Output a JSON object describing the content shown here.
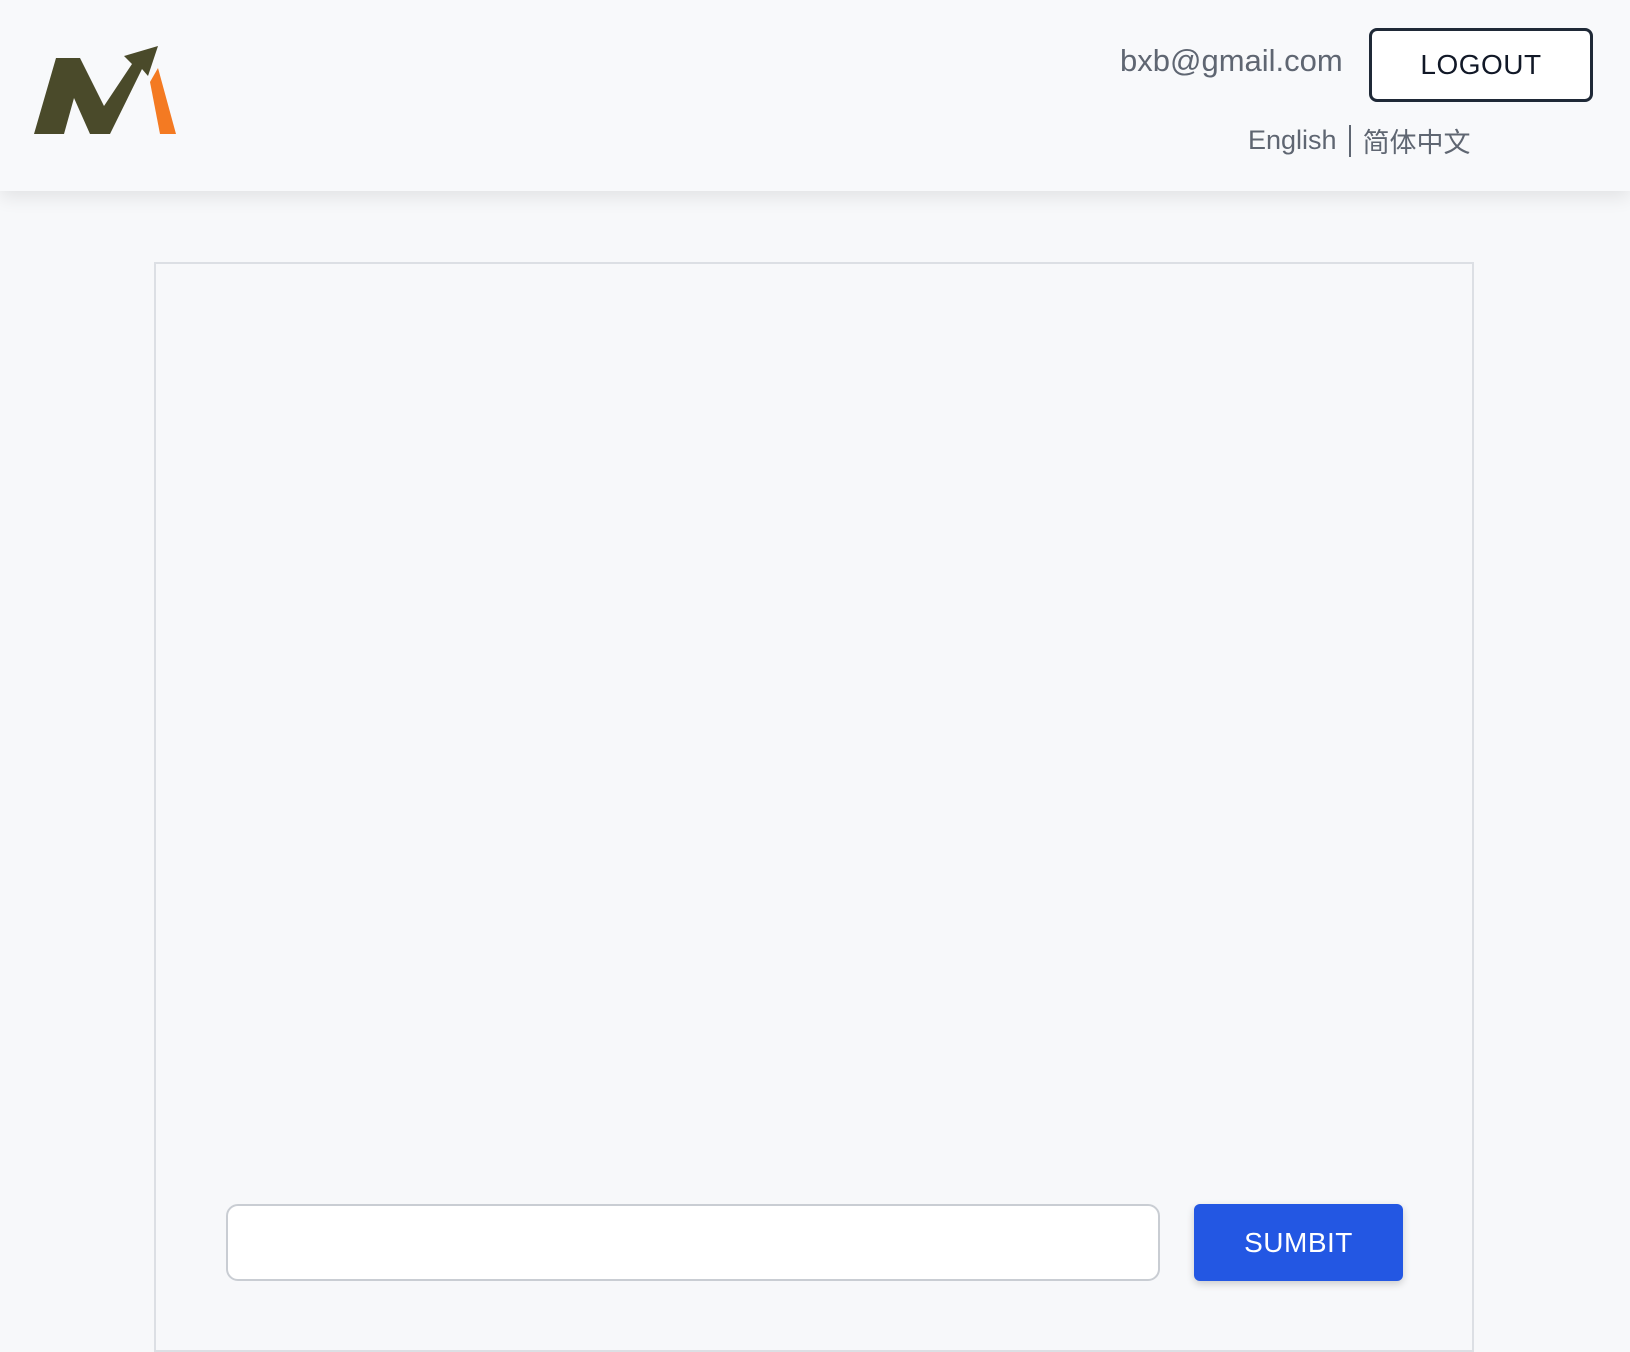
{
  "header": {
    "logo_icon": "m-logo-icon",
    "user_email": "bxb@gmail.com",
    "logout_label": "LOGOUT",
    "languages": [
      {
        "label": "English"
      },
      {
        "label": "简体中文"
      }
    ]
  },
  "chat": {
    "input_value": "",
    "input_placeholder": "",
    "submit_label": "SUMBIT"
  },
  "colors": {
    "logo_dark": "#4a4a2a",
    "logo_accent": "#f47a22",
    "submit_bg": "#2357e3",
    "page_bg": "#f7f8fa"
  }
}
